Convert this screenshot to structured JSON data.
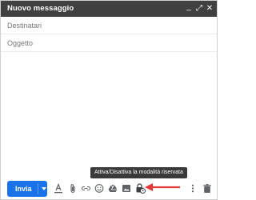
{
  "window": {
    "title": "Nuovo messaggio",
    "minimize_glyph": "_",
    "expand_glyph": "⤢",
    "close_glyph": "✕"
  },
  "fields": {
    "recipients_placeholder": "Destinatari",
    "subject_placeholder": "Oggetto"
  },
  "toolbar": {
    "send_label": "Invia",
    "icons": [
      "format-text-icon",
      "attach-icon",
      "link-icon",
      "emoji-icon",
      "drive-icon",
      "image-icon",
      "confidential-mode-icon",
      "more-options-icon",
      "delete-icon"
    ]
  },
  "tooltip": {
    "text": "Attiva/Disattiva la modalità riservata"
  },
  "colors": {
    "header": "#404040",
    "send_button": "#1a73e8",
    "tooltip_bg": "#3a3a3a",
    "annotation_arrow": "#e53935"
  }
}
